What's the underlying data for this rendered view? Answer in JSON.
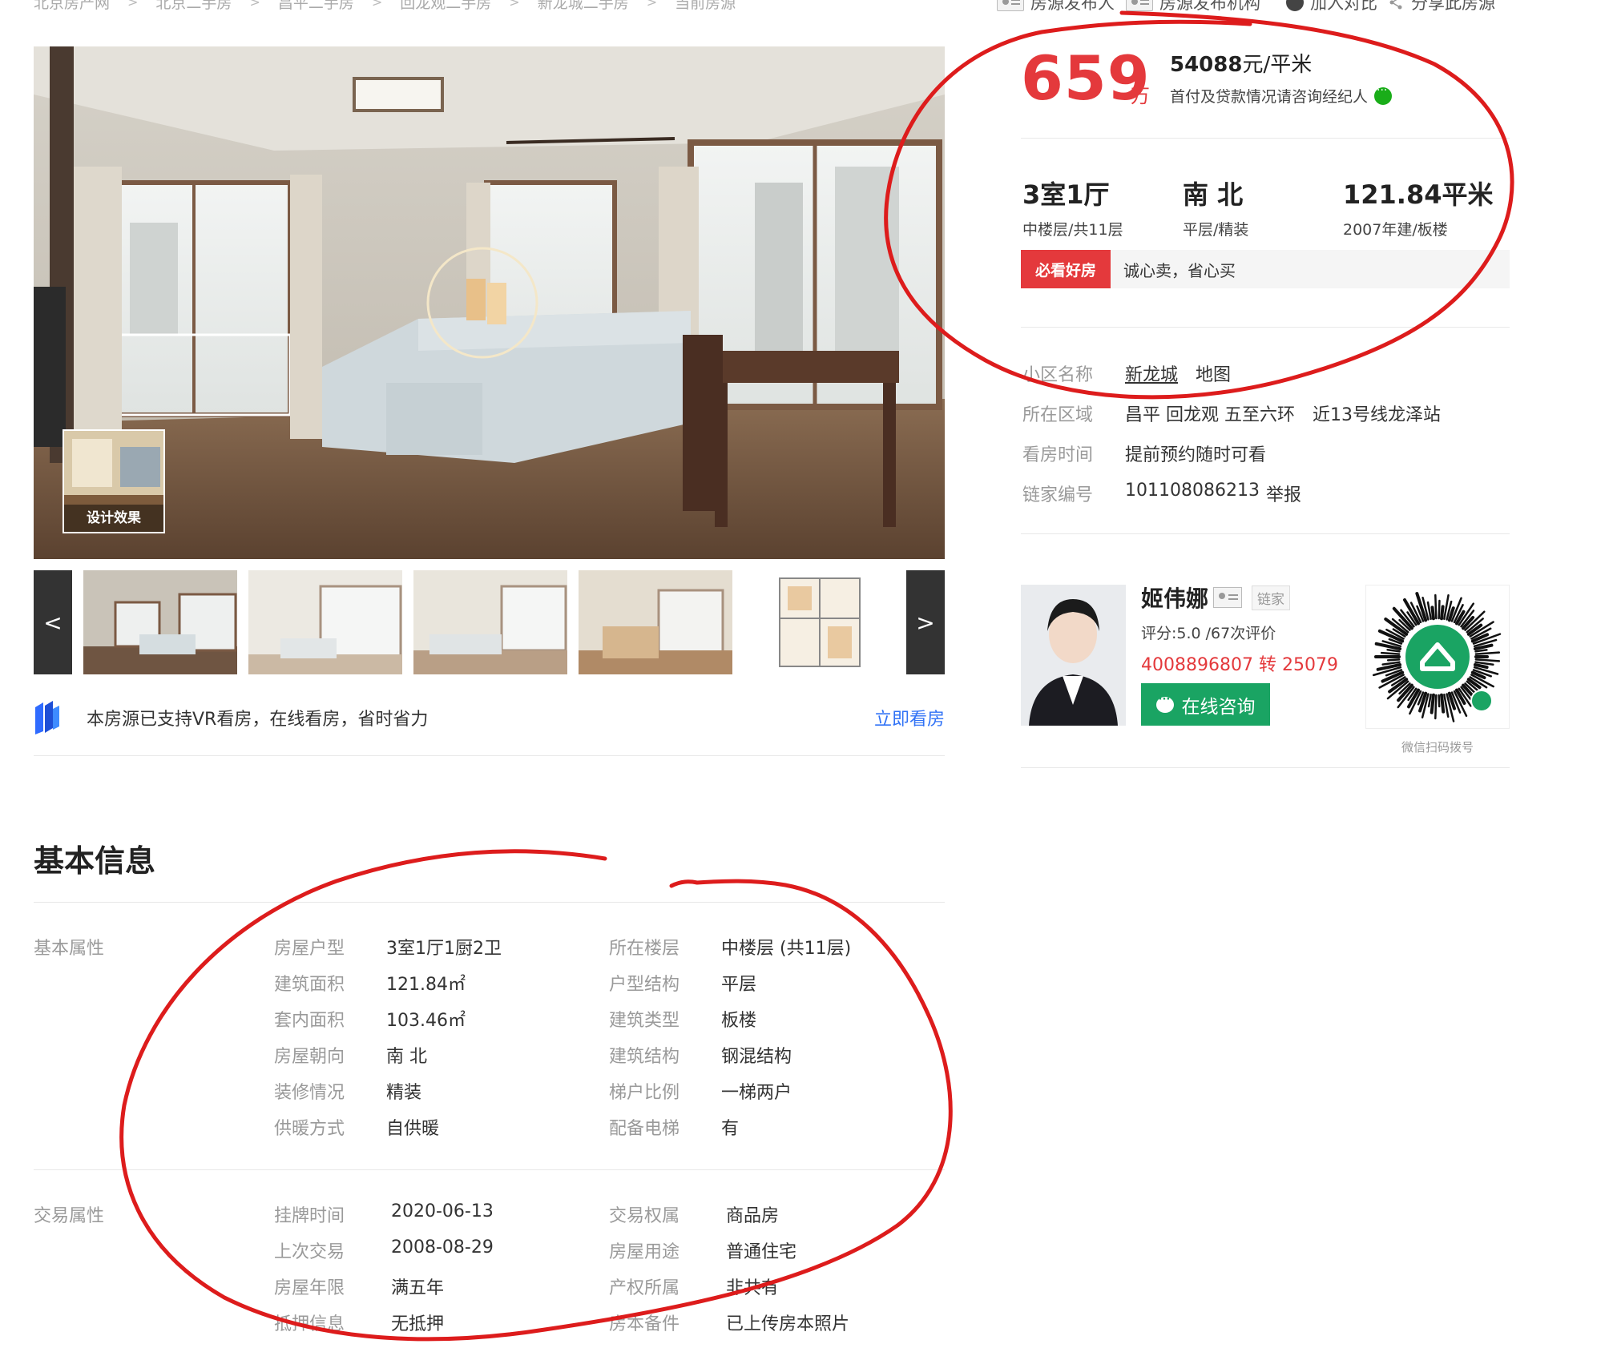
{
  "breadcrumb": [
    "北京房产网",
    "北京二手房",
    "昌平二手房",
    "回龙观二手房",
    "新龙城二手房",
    "当前房源"
  ],
  "top_actions": {
    "publisher": "房源发布人",
    "agency": "房源发布机构",
    "compare": "加入对比",
    "share": "分享此房源"
  },
  "gallery": {
    "design_label": "设计效果",
    "prev": "<",
    "next": ">",
    "vr_text": "本房源已支持VR看房，在线看房，省时省力",
    "vr_link": "立即看房"
  },
  "price": {
    "total": "659",
    "unit": "万",
    "per_area": "54088",
    "per_area_unit": "元/平米",
    "note": "首付及贷款情况请咨询经纪人"
  },
  "specs": [
    {
      "main": "3室1厅",
      "sub": "中楼层/共11层"
    },
    {
      "main": "南 北",
      "sub": "平层/精装"
    },
    {
      "main": "121.84平米",
      "sub": "2007年建/板楼"
    }
  ],
  "tag": {
    "label": "必看好房",
    "text": "诚心卖，省心买"
  },
  "info": {
    "community_key": "小区名称",
    "community": "新龙城",
    "map": "地图",
    "area_key": "所在区域",
    "area": "昌平 回龙观 五至六环",
    "subway": "近13号线龙泽站",
    "visit_key": "看房时间",
    "visit": "提前预约随时可看",
    "id_key": "链家编号",
    "id": "101108086213",
    "report": "举报"
  },
  "agent": {
    "name": "姬伟娜",
    "company": "链家",
    "rating": "评分:5.0 /67次评价",
    "phone": "4008896807 转 25079",
    "button": "在线咨询",
    "qr_caption": "微信扫码拨号"
  },
  "basic": {
    "title": "基本信息",
    "group1_label": "基本属性",
    "group1": [
      {
        "k": "房屋户型",
        "v": "3室1厅1厨2卫"
      },
      {
        "k": "所在楼层",
        "v": "中楼层 (共11层)"
      },
      {
        "k": "建筑面积",
        "v": "121.84㎡"
      },
      {
        "k": "户型结构",
        "v": "平层"
      },
      {
        "k": "套内面积",
        "v": "103.46㎡"
      },
      {
        "k": "建筑类型",
        "v": "板楼"
      },
      {
        "k": "房屋朝向",
        "v": "南 北"
      },
      {
        "k": "建筑结构",
        "v": "钢混结构"
      },
      {
        "k": "装修情况",
        "v": "精装"
      },
      {
        "k": "梯户比例",
        "v": "一梯两户"
      },
      {
        "k": "供暖方式",
        "v": "自供暖"
      },
      {
        "k": "配备电梯",
        "v": "有"
      }
    ],
    "group2_label": "交易属性",
    "group2": [
      {
        "k": "挂牌时间",
        "v": "2020-06-13"
      },
      {
        "k": "交易权属",
        "v": "商品房"
      },
      {
        "k": "上次交易",
        "v": "2008-08-29"
      },
      {
        "k": "房屋用途",
        "v": "普通住宅"
      },
      {
        "k": "房屋年限",
        "v": "满五年"
      },
      {
        "k": "产权所属",
        "v": "非共有"
      },
      {
        "k": "抵押信息",
        "v": "无抵押"
      },
      {
        "k": "房本备件",
        "v": "已上传房本照片"
      }
    ]
  },
  "colors": {
    "accent_red": "#e4393c",
    "link_blue": "#3072f6",
    "agent_green": "#1aa463",
    "annotation_red": "#dd1c1c"
  }
}
